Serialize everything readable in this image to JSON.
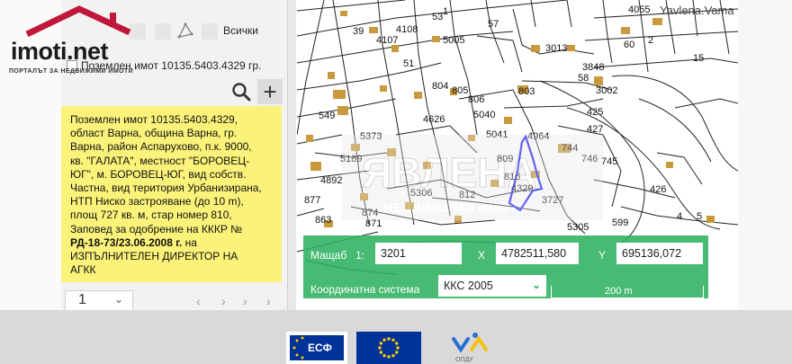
{
  "brand": {
    "name": "imoti.net",
    "tagline": "ПОРТАЛЪТ ЗА НЕДВИЖИМИ ИМОТИ"
  },
  "toolbar": {
    "layers_label": "Всички"
  },
  "plot": {
    "title": "Поземлен имот 10135.5403.4329 гр.",
    "info_lines": [
      "Поземлен имот 10135.5403.4329,",
      "област Варна, община Варна, гр.",
      "Варна, район Аспарухово, п.к. 9000,",
      "кв. \"ГАЛАТА\", местност \"БОРОВЕЦ-",
      "ЮГ\", м. БОРОВЕЦ-ЮГ, вид собств.",
      "Частна, вид територия Урбанизирана,",
      "НТП Ниско застрояване (до 10 m),",
      "площ 727 кв. м, стар номер 810,",
      "Заповед за одобрение на КККР №"
    ],
    "order_number": "РД-18-73/23.06.2008 г.",
    "order_suffix": " на",
    "info_tail": [
      "ИЗПЪЛНИТЕЛЕН ДИРЕКТОР НА",
      "АГКК"
    ]
  },
  "pager": {
    "page_value": "1"
  },
  "map": {
    "watermark_text": "Yavlena.Vama",
    "overlay_main": "ЯВЛЕНА",
    "overlay_sub": "НЕДВИЖИМИ ИМОТИ",
    "parcel_labels": [
      {
        "t": "4055",
        "k": "a"
      },
      {
        "t": "53",
        "k": "b"
      },
      {
        "t": "4108",
        "k": "c"
      },
      {
        "t": "5005",
        "k": "d"
      },
      {
        "t": "3013",
        "k": "e"
      },
      {
        "t": "60",
        "k": "f"
      },
      {
        "t": "4107",
        "k": "g"
      },
      {
        "t": "3848",
        "k": "h"
      },
      {
        "t": "58",
        "k": "i"
      },
      {
        "t": "804",
        "k": "j"
      },
      {
        "t": "805",
        "k": "k"
      },
      {
        "t": "803",
        "k": "l"
      },
      {
        "t": "3002",
        "k": "m"
      },
      {
        "t": "806",
        "k": "n"
      },
      {
        "t": "5040",
        "k": "o"
      },
      {
        "t": "425",
        "k": "p"
      },
      {
        "t": "4626",
        "k": "q"
      },
      {
        "t": "549",
        "k": "r"
      },
      {
        "t": "5373",
        "k": "s"
      },
      {
        "t": "5041",
        "k": "t"
      },
      {
        "t": "4964",
        "k": "u"
      },
      {
        "t": "427",
        "k": "v"
      },
      {
        "t": "746",
        "k": "w"
      },
      {
        "t": "745",
        "k": "x"
      },
      {
        "t": "809",
        "k": "y"
      },
      {
        "t": "5189",
        "k": "z"
      },
      {
        "t": "4892",
        "k": "aa"
      },
      {
        "t": "5306",
        "k": "ab"
      },
      {
        "t": "812",
        "k": "ac"
      },
      {
        "t": "3727",
        "k": "ad"
      },
      {
        "t": "426",
        "k": "ae"
      },
      {
        "t": "877",
        "k": "af"
      },
      {
        "t": "5305",
        "k": "ag"
      },
      {
        "t": "599",
        "k": "ah"
      },
      {
        "t": "4329",
        "k": "ai"
      },
      {
        "t": "874",
        "k": "aj"
      },
      {
        "t": "1",
        "k": "ak"
      },
      {
        "t": "2",
        "k": "al"
      },
      {
        "t": "39",
        "k": "am"
      },
      {
        "t": "57",
        "k": "an"
      },
      {
        "t": "4",
        "k": "ao"
      },
      {
        "t": "5",
        "k": "ap"
      },
      {
        "t": "51",
        "k": "aq"
      },
      {
        "t": "816",
        "k": "ar"
      },
      {
        "t": "871",
        "k": "as"
      },
      {
        "t": "15",
        "k": "at"
      },
      {
        "t": "863",
        "k": "au"
      },
      {
        "t": "744",
        "k": "av"
      }
    ]
  },
  "coords": {
    "scale_label": "Мащаб",
    "scale_prefix": "1:",
    "scale_value": "3201",
    "x_label": "X",
    "x_value": "4782511,580",
    "y_label": "Y",
    "y_value": "695136,072",
    "crs_label": "Координатна система",
    "crs_value": "ККС 2005",
    "scale_bar_label": "200 m"
  },
  "footer": {
    "esf_text": "ЕСФ",
    "opdu_text": "ОПДУ"
  },
  "colors": {
    "accent_green": "#2eb260",
    "info_yellow": "#fbf27a",
    "parcel_highlight": "#1a1aff",
    "building": "#c99a3d",
    "brand_red": "#c0163a",
    "eu_blue": "#003399",
    "eu_gold": "#ffcc00"
  }
}
